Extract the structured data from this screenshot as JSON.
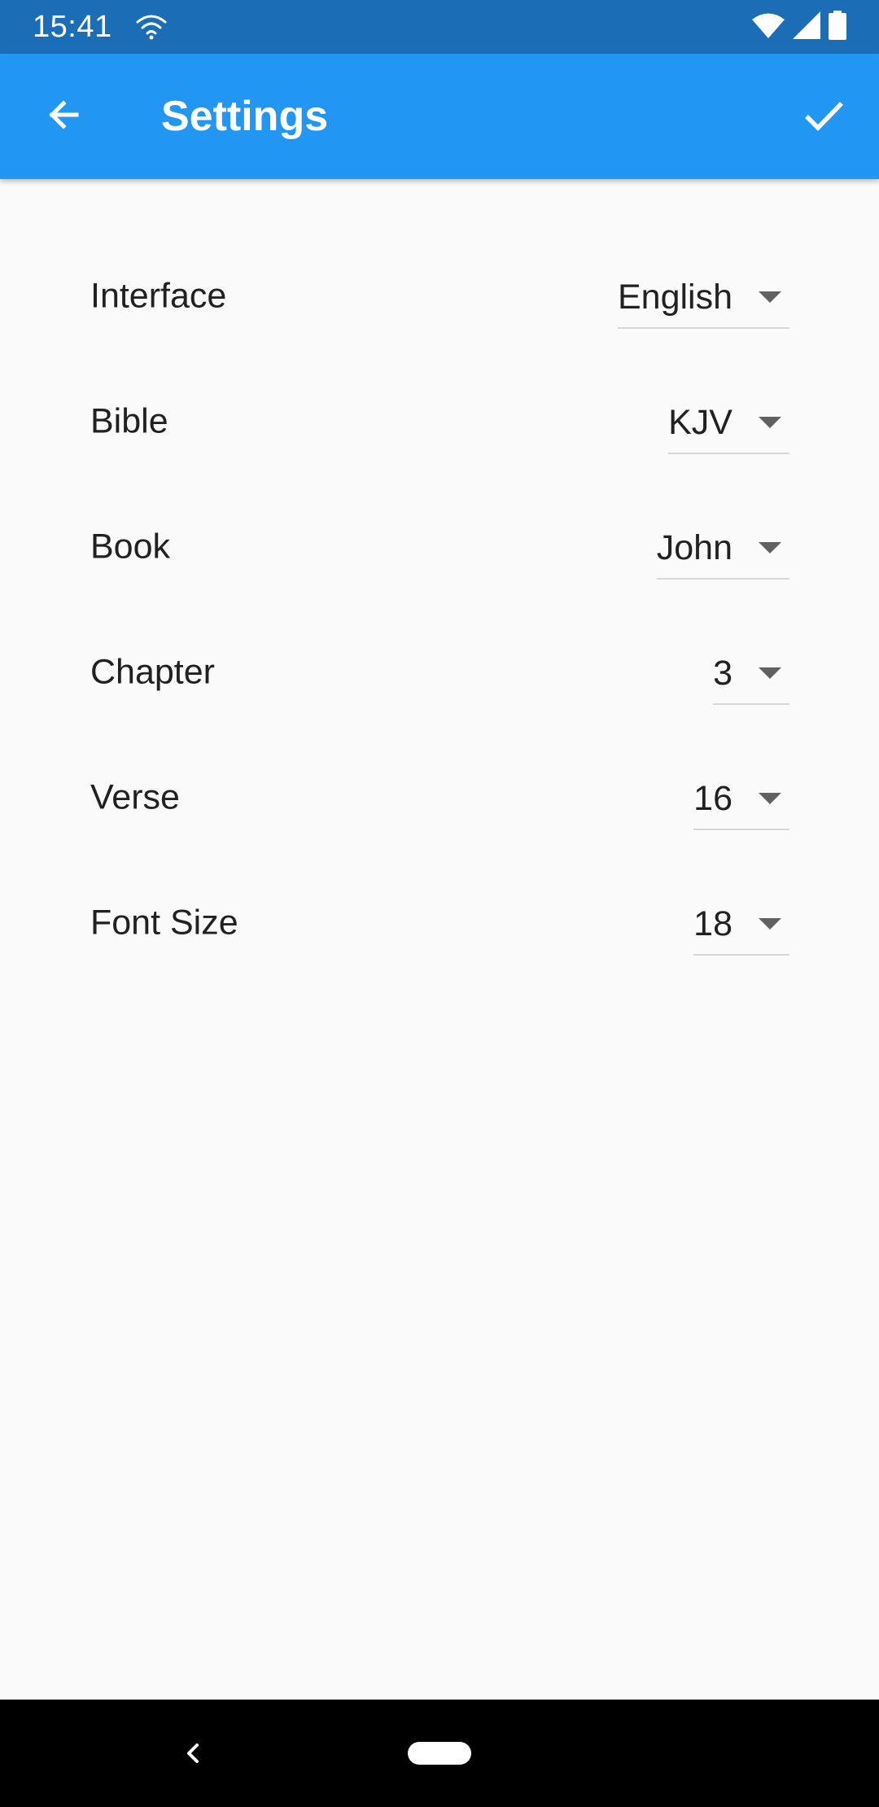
{
  "status_bar": {
    "time": "15:41",
    "icons": [
      "wifi-outline-icon",
      "wifi-icon",
      "signal-icon",
      "battery-icon"
    ]
  },
  "app_bar": {
    "title": "Settings",
    "back_icon": "arrow-left-icon",
    "confirm_icon": "check-icon",
    "color": "#2196F3"
  },
  "settings": [
    {
      "label": "Interface",
      "value": "English"
    },
    {
      "label": "Bible",
      "value": "KJV"
    },
    {
      "label": "Book",
      "value": "John"
    },
    {
      "label": "Chapter",
      "value": "3"
    },
    {
      "label": "Verse",
      "value": "16"
    },
    {
      "label": "Font Size",
      "value": "18"
    }
  ],
  "nav_bar": {
    "icons": [
      "nav-back-icon",
      "nav-home-pill"
    ]
  }
}
